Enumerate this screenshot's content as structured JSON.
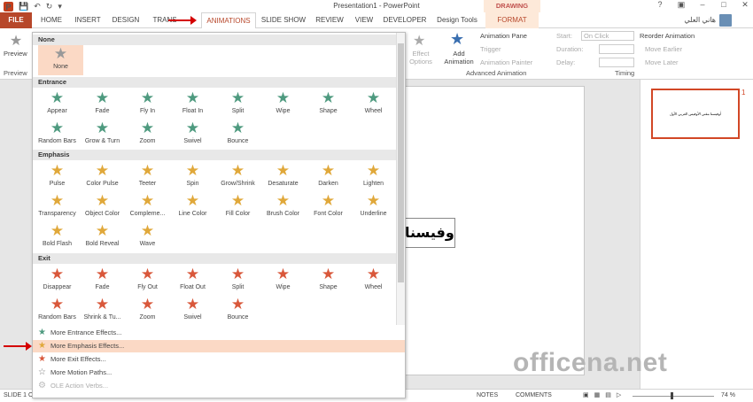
{
  "window": {
    "title": "Presentation1 - PowerPoint",
    "drawing_tools": "DRAWING TOOLS"
  },
  "tabs": [
    "FILE",
    "HOME",
    "INSERT",
    "DESIGN",
    "TRANS",
    "ANIMATIONS",
    "SLIDE SHOW",
    "REVIEW",
    "VIEW",
    "DEVELOPER",
    "Design Tools",
    "FORMAT"
  ],
  "user": "هاني العلي",
  "ribbon": {
    "preview": "Preview",
    "preview_group": "Preview",
    "effect_options": "Effect Options",
    "add_animation": "Add Animation",
    "animation_pane": "Animation Pane",
    "trigger": "Trigger",
    "animation_painter": "Animation Painter",
    "advanced_group": "Advanced Animation",
    "start": "Start:",
    "start_value": "On Click",
    "duration": "Duration:",
    "delay": "Delay:",
    "reorder": "Reorder Animation",
    "move_earlier": "Move Earlier",
    "move_later": "Move Later",
    "timing_group": "Timing"
  },
  "gallery": {
    "none_section": "None",
    "none_item": "None",
    "entrance_section": "Entrance",
    "entrance": [
      "Appear",
      "Fade",
      "Fly In",
      "Float In",
      "Split",
      "Wipe",
      "Shape",
      "Wheel",
      "Random Bars",
      "Grow & Turn",
      "Zoom",
      "Swivel",
      "Bounce"
    ],
    "emphasis_section": "Emphasis",
    "emphasis": [
      "Pulse",
      "Color Pulse",
      "Teeter",
      "Spin",
      "Grow/Shrink",
      "Desaturate",
      "Darken",
      "Lighten",
      "Transparency",
      "Object Color",
      "Compleme...",
      "Line Color",
      "Fill Color",
      "Brush Color",
      "Font Color",
      "Underline",
      "Bold Flash",
      "Bold Reveal",
      "Wave"
    ],
    "exit_section": "Exit",
    "exit": [
      "Disappear",
      "Fade",
      "Fly Out",
      "Float Out",
      "Split",
      "Wipe",
      "Shape",
      "Wheel",
      "Random Bars",
      "Shrink & Tu...",
      "Zoom",
      "Swivel",
      "Bounce"
    ],
    "more": [
      "More Entrance Effects...",
      "More Emphasis Effects...",
      "More Exit Effects...",
      "More Motion Paths...",
      "OLE Action Verbs..."
    ]
  },
  "colors": {
    "entrance": "#4e9a7f",
    "emphasis": "#e0a83a",
    "exit": "#d9583b",
    "accent": "#b7472a"
  },
  "slide": {
    "text": "أوفيسنا",
    "thumb_text": "أوفيسنا مقتي الأوفيس العربي الأول",
    "number": "1"
  },
  "watermark": "officena.net",
  "status": {
    "slide": "SLIDE 1 OF 1",
    "notes": "NOTES",
    "comments": "COMMENTS",
    "zoom": "74 %"
  }
}
